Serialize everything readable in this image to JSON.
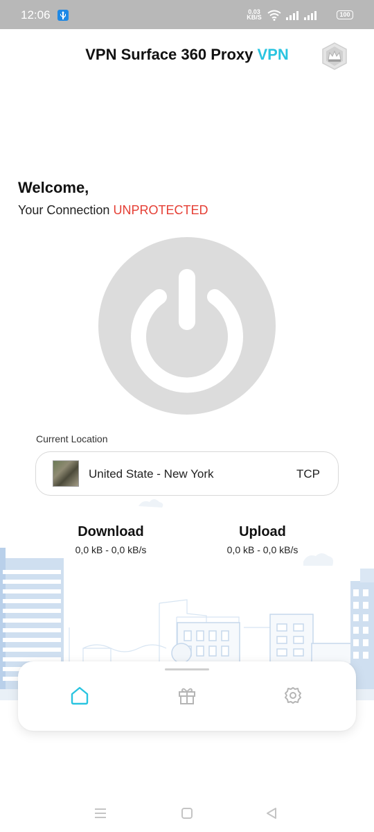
{
  "status_bar": {
    "time": "12:06",
    "net_speed_top": "0.03",
    "net_speed_bottom": "KB/S",
    "battery": "100",
    "icons": [
      "usb-icon",
      "wifi-icon",
      "signal-icon",
      "signal-icon",
      "battery-icon"
    ]
  },
  "header": {
    "title_main": "VPN Surface 360 Proxy",
    "title_accent": "VPN",
    "premium_icon": "crown-icon"
  },
  "welcome": {
    "greeting": "Welcome,",
    "connection_prefix": "Your Connection",
    "connection_status": "UNPROTECTED"
  },
  "power": {
    "icon": "power-icon"
  },
  "location": {
    "label": "Current Location",
    "name": "United State - New York",
    "protocol": "TCP"
  },
  "stats": {
    "download_label": "Download",
    "download_value": "0,0 kB - 0,0 kB/s",
    "upload_label": "Upload",
    "upload_value": "0,0 kB - 0,0 kB/s"
  },
  "bottom_nav": {
    "items": [
      {
        "name": "home",
        "icon": "home-icon",
        "active": true
      },
      {
        "name": "gift",
        "icon": "gift-icon",
        "active": false
      },
      {
        "name": "settings",
        "icon": "settings-icon",
        "active": false
      }
    ]
  },
  "colors": {
    "accent": "#29c4e0",
    "danger": "#e53e34",
    "power_bg": "#dcdcdc",
    "status_bar": "#b8b8b8"
  }
}
